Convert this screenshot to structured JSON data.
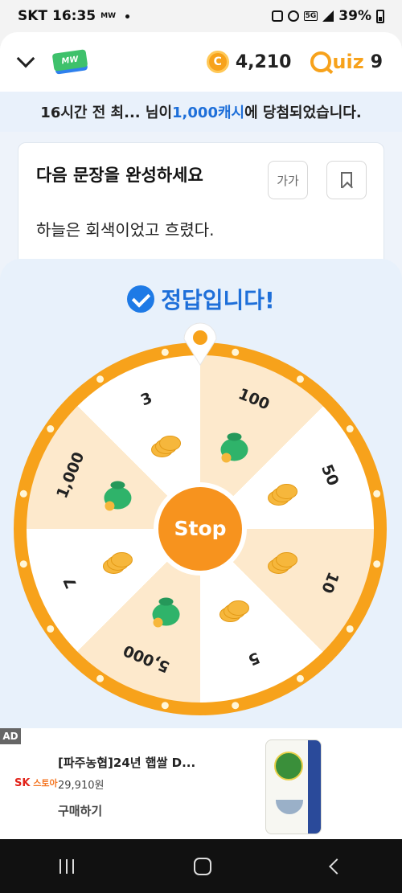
{
  "status_bar": {
    "carrier": "SKT",
    "time": "16:35",
    "mini_label": "MW",
    "network": "5G",
    "battery": "39%"
  },
  "header": {
    "logo_text": "MW",
    "coin_symbol": "C",
    "coin_count": "4,210",
    "quiz_label": "uiz",
    "quiz_count": "9"
  },
  "banner": {
    "prefix": "16시간 전 최... 님이 ",
    "highlight": "1,000캐시",
    "suffix": "에 당첨되었습니다."
  },
  "question": {
    "title": "다음 문장을 완성하세요",
    "font_size_button": "가가",
    "sentence": "하늘은 회색이었고 흐렸다."
  },
  "result": {
    "message": "정답입니다!"
  },
  "wheel": {
    "stop_label": "Stop",
    "segments": [
      {
        "label": "100",
        "reward": "money-bag"
      },
      {
        "label": "50",
        "reward": "coin-stack"
      },
      {
        "label": "10",
        "reward": "coin-stack"
      },
      {
        "label": "5",
        "reward": "coin-stack"
      },
      {
        "label": "5,000",
        "reward": "money-bag"
      },
      {
        "label": "7",
        "reward": "coin-stack"
      },
      {
        "label": "1,000",
        "reward": "money-bag"
      },
      {
        "label": "3",
        "reward": "coin-stack"
      }
    ],
    "colors": {
      "rim": "#f7a21b",
      "segment_light": "#ffffff",
      "segment_shade": "#fde9cc",
      "stop_button": "#f7931e",
      "pointer": "#ffffff"
    }
  },
  "ad": {
    "badge": "AD",
    "advertiser_logo_sk": "SK",
    "advertiser_logo_store": "스토아",
    "title": "[파주농협]24년 햅쌀 D...",
    "price": "29,910원",
    "cta": "구매하기"
  },
  "colors": {
    "accent_blue": "#1e6fd9",
    "accent_orange": "#f7a21b",
    "banner_bg": "#e9f1fb"
  }
}
